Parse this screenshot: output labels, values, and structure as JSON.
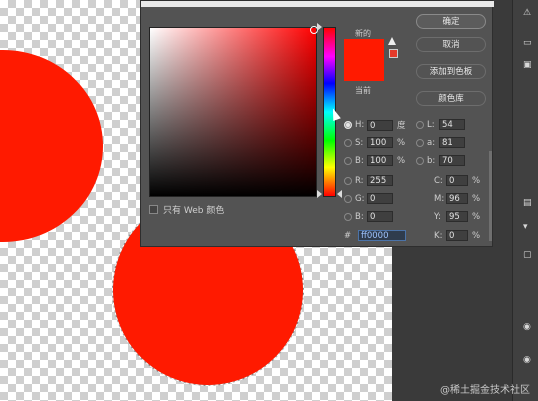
{
  "colors": {
    "fill": "#ff1a00",
    "dialog_bg": "#535353",
    "hex_highlight": "#2f3c4d"
  },
  "picker": {
    "new_label": "新的",
    "current_label": "当前",
    "new_color": "#ff1a00",
    "current_color": "#ff1a00",
    "gamut_warning_swatch": "#e53a2a",
    "web_only_label": "只有 Web 颜色"
  },
  "buttons": {
    "ok": "确定",
    "cancel": "取消",
    "add_to_swatches": "添加到色板",
    "color_libraries": "颜色库"
  },
  "fields": {
    "H": {
      "label": "H:",
      "value": "0",
      "unit": "度"
    },
    "S": {
      "label": "S:",
      "value": "100",
      "unit": "%"
    },
    "B": {
      "label": "B:",
      "value": "100",
      "unit": "%"
    },
    "R": {
      "label": "R:",
      "value": "255"
    },
    "G": {
      "label": "G:",
      "value": "0"
    },
    "Bl": {
      "label": "B:",
      "value": "0"
    },
    "L": {
      "label": "L:",
      "value": "54"
    },
    "a": {
      "label": "a:",
      "value": "81"
    },
    "b": {
      "label": "b:",
      "value": "70"
    },
    "C": {
      "label": "C:",
      "value": "0",
      "unit": "%"
    },
    "M": {
      "label": "M:",
      "value": "96",
      "unit": "%"
    },
    "Y": {
      "label": "Y:",
      "value": "95",
      "unit": "%"
    },
    "K": {
      "label": "K:",
      "value": "0",
      "unit": "%"
    },
    "hex": {
      "label": "#",
      "value": "ff0000"
    }
  },
  "watermark": "@稀土掘金技术社区"
}
